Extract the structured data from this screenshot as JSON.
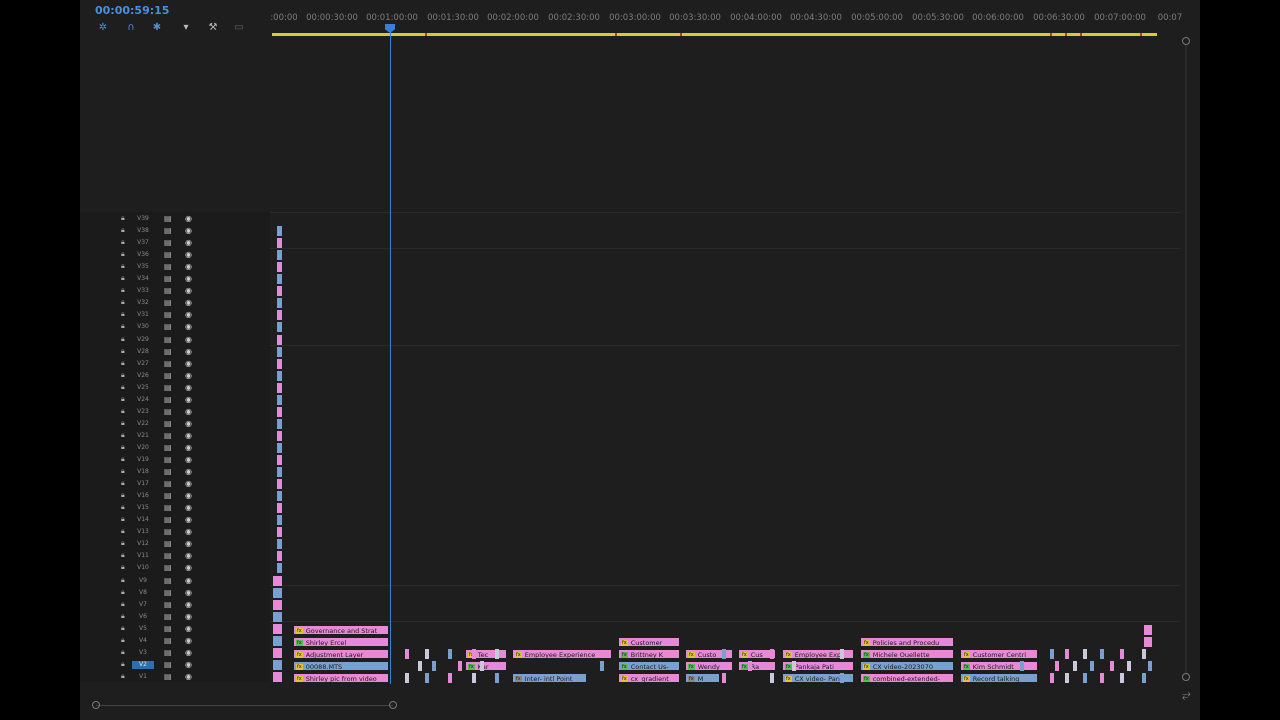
{
  "timeline": {
    "timecode": "00:00:59:15",
    "ruler_labels": [
      ":00:00",
      "00:00:30:00",
      "00:01:00:00",
      "00:01:30:00",
      "00:02:00:00",
      "00:02:30:00",
      "00:03:00:00",
      "00:03:30:00",
      "00:04:00:00",
      "00:04:30:00",
      "00:05:00:00",
      "00:05:30:00",
      "00:06:00:00",
      "00:06:30:00",
      "00:07:00:00",
      "00:07"
    ],
    "tools": [
      "insert-sequence-icon",
      "snap-icon",
      "linked-selection-icon",
      "add-marker-icon",
      "wrench-icon",
      "captions-icon"
    ],
    "tracks": [
      "V39",
      "V38",
      "V37",
      "V36",
      "V35",
      "V34",
      "V33",
      "V32",
      "V31",
      "V30",
      "V29",
      "V28",
      "V27",
      "V26",
      "V25",
      "V24",
      "V23",
      "V22",
      "V21",
      "V20",
      "V19",
      "V18",
      "V17",
      "V16",
      "V15",
      "V14",
      "V13",
      "V12",
      "V11",
      "V10",
      "V9",
      "V8",
      "V7",
      "V6",
      "V5",
      "V4",
      "V3",
      "V2",
      "V1"
    ],
    "selected_track": "V2",
    "clips": {
      "governance": "Governance and Strat",
      "shirley_ercel": "Shirley Ercel",
      "adjustment": "Adjustment Layer",
      "mts": "00088.MTS",
      "shirley_pic": "Shirley pic from video",
      "tec": "Tec",
      "kar": "Kar",
      "employee_experience": "Employee Experience",
      "customer": "Customer",
      "brittney": "Brittney K",
      "contact_us": "Contact Us-",
      "intro_point": "Inter- intl Point",
      "cx_gradient": "cx_gradient",
      "custo": "Custo",
      "wendy": "Wendy",
      "m": "M",
      "cus": "Cus",
      "ra": "Ra",
      "employee_exp2": "Employee Exp",
      "pankaja": "Pankaja Pati",
      "cx_video_pank": "CX video- Pank",
      "policies": "Policies and Procedu",
      "michele": "Michele Ouellette",
      "cx_video_2023": "CX video-2023070",
      "combined": "combined-extended-",
      "customer_centri": "Customer Centri",
      "kim": "Kim Schmidt",
      "record": "Record talking"
    }
  }
}
